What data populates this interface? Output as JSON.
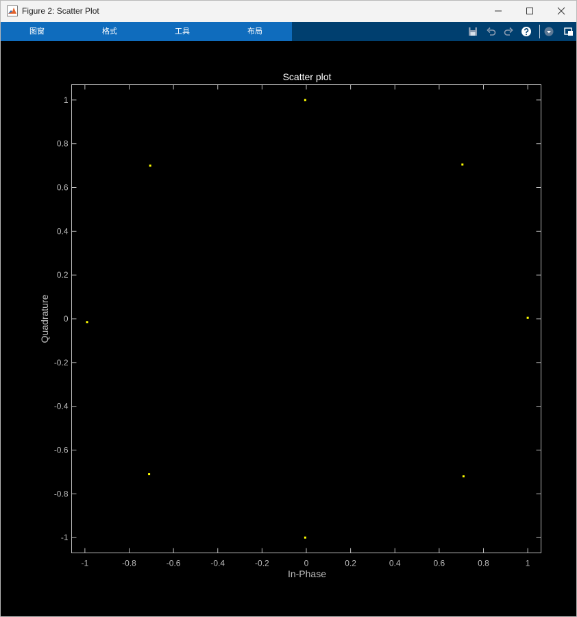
{
  "window": {
    "title": "Figure 2: Scatter Plot"
  },
  "ribbon": {
    "tabs": [
      {
        "label": "图窗"
      },
      {
        "label": "格式"
      },
      {
        "label": "工具"
      },
      {
        "label": "布局"
      }
    ],
    "tool_icons": [
      "save-icon",
      "undo-icon",
      "redo-icon",
      "help-icon",
      "dropdown-icon",
      "undock-icon"
    ]
  },
  "colors": {
    "ribbon_tabs_bg": "#0f6cbd",
    "ribbon_bg": "#003f6f",
    "plot_bg": "#000000",
    "axis": "#bdbdbd",
    "marker": "#ffff00"
  },
  "chart_data": {
    "type": "scatter",
    "title": "Scatter plot",
    "xlabel": "In-Phase",
    "ylabel": "Quadrature",
    "xlim": [
      -1.06,
      1.06
    ],
    "ylim": [
      -1.07,
      1.07
    ],
    "xticks": [
      -1,
      -0.8,
      -0.6,
      -0.4,
      -0.2,
      0,
      0.2,
      0.4,
      0.6,
      0.8,
      1
    ],
    "xtick_labels": [
      "-1",
      "-0.8",
      "-0.6",
      "-0.4",
      "-0.2",
      "0",
      "0.2",
      "0.4",
      "0.6",
      "0.8",
      "1"
    ],
    "yticks": [
      1,
      0.8,
      0.6,
      0.4,
      0.2,
      0,
      -0.2,
      -0.4,
      -0.6,
      -0.8,
      -1
    ],
    "ytick_labels": [
      "1",
      "0.8",
      "0.6",
      "0.4",
      "0.2",
      "0",
      "-0.2",
      "-0.4",
      "-0.6",
      "-0.8",
      "-1"
    ],
    "grid": false,
    "points": [
      {
        "x": -0.005,
        "y": 1.0
      },
      {
        "x": 0.705,
        "y": 0.705
      },
      {
        "x": -0.705,
        "y": 0.7
      },
      {
        "x": -0.99,
        "y": -0.015
      },
      {
        "x": 1.0,
        "y": 0.005
      },
      {
        "x": -0.71,
        "y": -0.71
      },
      {
        "x": 0.71,
        "y": -0.72
      },
      {
        "x": -0.005,
        "y": -1.0
      }
    ]
  }
}
